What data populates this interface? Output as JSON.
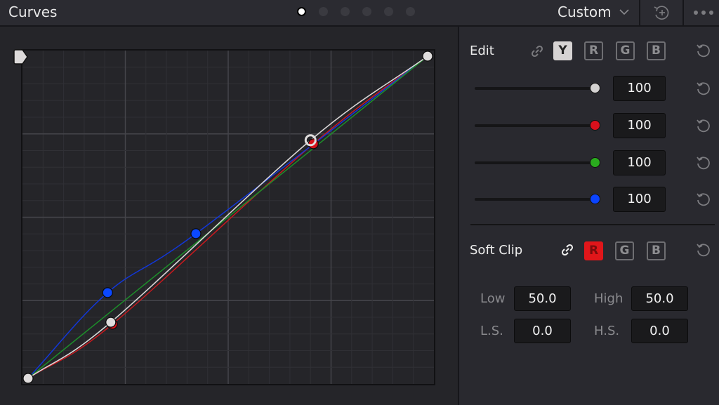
{
  "header": {
    "title": "Curves",
    "page_dots": {
      "count": 6,
      "active_index": 0
    },
    "preset": {
      "label": "Custom",
      "icon": "chevron-down-icon"
    },
    "actions": [
      {
        "name": "add-version",
        "icon": "reset-plus-icon"
      },
      {
        "name": "more-options",
        "icon": "ellipsis-icon"
      }
    ]
  },
  "curves": {
    "grid": {
      "major_divisions": 4,
      "minor_per_major": 5
    },
    "channels": [
      {
        "name": "luma",
        "color": "#d9d6d6",
        "points": [
          [
            0,
            0
          ],
          [
            0.207,
            0.174
          ],
          [
            0.707,
            0.739
          ],
          [
            1,
            1
          ]
        ],
        "selected_index": 2
      },
      {
        "name": "red",
        "color": "#c8191e",
        "points": [
          [
            0,
            0
          ],
          [
            0.211,
            0.168
          ],
          [
            0.714,
            0.728
          ],
          [
            1,
            1
          ]
        ]
      },
      {
        "name": "green",
        "color": "#1d8f2a",
        "points": [
          [
            0,
            0
          ],
          [
            1,
            1
          ]
        ]
      },
      {
        "name": "blue",
        "color": "#1237d9",
        "points": [
          [
            0,
            0
          ],
          [
            0.199,
            0.266
          ],
          [
            0.42,
            0.449
          ],
          [
            1,
            1
          ]
        ]
      }
    ]
  },
  "edit": {
    "label": "Edit",
    "link_icon": "link-icon",
    "channel_buttons": [
      {
        "label": "Y",
        "active": true
      },
      {
        "label": "R",
        "active": false
      },
      {
        "label": "G",
        "active": false
      },
      {
        "label": "B",
        "active": false
      }
    ],
    "sliders": [
      {
        "channel": "luma",
        "value": "100",
        "fraction": 1.0,
        "color": "#d4d2d2"
      },
      {
        "channel": "red",
        "value": "100",
        "fraction": 1.0,
        "color": "#d8101c"
      },
      {
        "channel": "green",
        "value": "100",
        "fraction": 1.0,
        "color": "#2aac1e"
      },
      {
        "channel": "blue",
        "value": "100",
        "fraction": 1.0,
        "color": "#0b44ff"
      }
    ]
  },
  "soft_clip": {
    "label": "Soft Clip",
    "link_icon": "link-icon",
    "channel_buttons": [
      {
        "label": "R",
        "active": true
      },
      {
        "label": "G",
        "active": false
      },
      {
        "label": "B",
        "active": false
      }
    ],
    "fields": {
      "low": {
        "label": "Low",
        "value": "50.0"
      },
      "high": {
        "label": "High",
        "value": "50.0"
      },
      "ls": {
        "label": "L.S.",
        "value": "0.0"
      },
      "hs": {
        "label": "H.S.",
        "value": "0.0"
      }
    }
  }
}
